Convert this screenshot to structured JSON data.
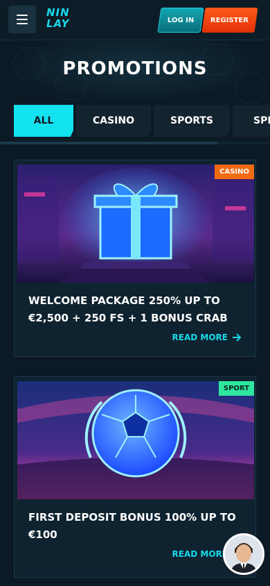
{
  "header": {
    "logo_line1": "NIN",
    "logo_line2": "LAY",
    "login_label": "LOG IN",
    "register_label": "REGISTER"
  },
  "page": {
    "title": "PROMOTIONS"
  },
  "tabs": [
    {
      "label": "ALL",
      "active": true
    },
    {
      "label": "CASINO",
      "active": false
    },
    {
      "label": "SPORTS",
      "active": false
    },
    {
      "label": "SPE",
      "active": false
    }
  ],
  "promotions": [
    {
      "badge": "CASINO",
      "title": "WELCOME PACKAGE 250% UP TO €2,500 + 250 FS + 1 BONUS CRAB",
      "cta": "READ MORE"
    },
    {
      "badge": "SPORT",
      "title": "FIRST DEPOSIT BONUS 100% UP TO €100",
      "cta": "READ MORE"
    }
  ],
  "colors": {
    "accent": "#19d8e8",
    "register": "#f23c10",
    "casino_badge": "#f26a12",
    "sport_badge": "#2ee6a0",
    "background": "#0b1a24"
  },
  "icons": {
    "menu": "hamburger-icon",
    "arrow": "arrow-right-icon",
    "support": "support-agent-avatar"
  }
}
